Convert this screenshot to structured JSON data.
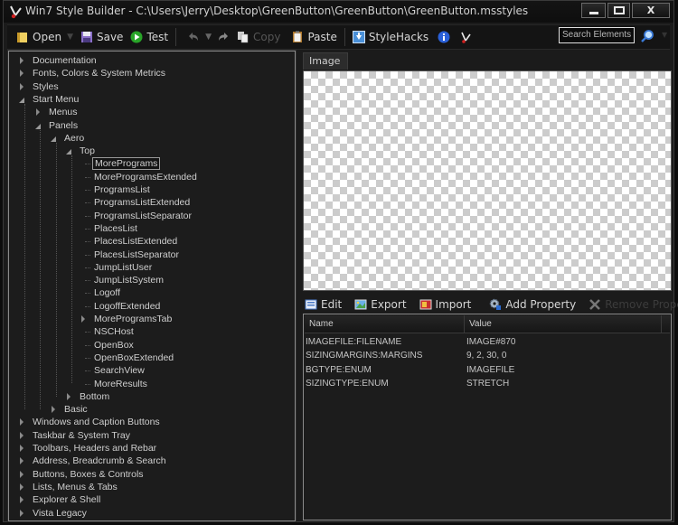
{
  "window": {
    "title": "Win7 Style Builder - C:\\Users\\Jerry\\Desktop\\GreenButton\\GreenButton\\GreenButton.msstyles",
    "caption_buttons": {
      "minimize": "▁",
      "maximize": "□",
      "close": "X"
    }
  },
  "toolbar": {
    "open": "Open",
    "save": "Save",
    "test": "Test",
    "copy": "Copy",
    "paste": "Paste",
    "stylehacks": "StyleHacks",
    "search_placeholder": "Search Elements"
  },
  "tree": {
    "items": [
      {
        "label": "Documentation",
        "level": 0,
        "state": "collapsed"
      },
      {
        "label": "Fonts, Colors & System Metrics",
        "level": 0,
        "state": "collapsed"
      },
      {
        "label": "Styles",
        "level": 0,
        "state": "collapsed"
      },
      {
        "label": "Start Menu",
        "level": 0,
        "state": "expanded"
      },
      {
        "label": "Menus",
        "level": 1,
        "state": "collapsed"
      },
      {
        "label": "Panels",
        "level": 1,
        "state": "expanded"
      },
      {
        "label": "Aero",
        "level": 2,
        "state": "expanded"
      },
      {
        "label": "Top",
        "level": 3,
        "state": "expanded"
      },
      {
        "label": "MorePrograms",
        "level": 4,
        "state": "leaf",
        "selected": true
      },
      {
        "label": "MoreProgramsExtended",
        "level": 4,
        "state": "leaf"
      },
      {
        "label": "ProgramsList",
        "level": 4,
        "state": "leaf"
      },
      {
        "label": "ProgramsListExtended",
        "level": 4,
        "state": "leaf"
      },
      {
        "label": "ProgramsListSeparator",
        "level": 4,
        "state": "leaf"
      },
      {
        "label": "PlacesList",
        "level": 4,
        "state": "leaf"
      },
      {
        "label": "PlacesListExtended",
        "level": 4,
        "state": "leaf"
      },
      {
        "label": "PlacesListSeparator",
        "level": 4,
        "state": "leaf"
      },
      {
        "label": "JumpListUser",
        "level": 4,
        "state": "leaf"
      },
      {
        "label": "JumpListSystem",
        "level": 4,
        "state": "leaf"
      },
      {
        "label": "Logoff",
        "level": 4,
        "state": "leaf"
      },
      {
        "label": "LogoffExtended",
        "level": 4,
        "state": "leaf"
      },
      {
        "label": "MoreProgramsTab",
        "level": 4,
        "state": "collapsed"
      },
      {
        "label": "NSCHost",
        "level": 4,
        "state": "leaf"
      },
      {
        "label": "OpenBox",
        "level": 4,
        "state": "leaf"
      },
      {
        "label": "OpenBoxExtended",
        "level": 4,
        "state": "leaf"
      },
      {
        "label": "SearchView",
        "level": 4,
        "state": "leaf"
      },
      {
        "label": "MoreResults",
        "level": 4,
        "state": "leaf"
      },
      {
        "label": "Bottom",
        "level": 3,
        "state": "collapsed"
      },
      {
        "label": "Basic",
        "level": 2,
        "state": "collapsed"
      },
      {
        "label": "Windows and Caption Buttons",
        "level": 0,
        "state": "collapsed"
      },
      {
        "label": "Taskbar & System Tray",
        "level": 0,
        "state": "collapsed"
      },
      {
        "label": "Toolbars, Headers and Rebar",
        "level": 0,
        "state": "collapsed"
      },
      {
        "label": "Address, Breadcrumb & Search",
        "level": 0,
        "state": "collapsed"
      },
      {
        "label": "Buttons, Boxes & Controls",
        "level": 0,
        "state": "collapsed"
      },
      {
        "label": "Lists, Menus & Tabs",
        "level": 0,
        "state": "collapsed"
      },
      {
        "label": "Explorer & Shell",
        "level": 0,
        "state": "collapsed"
      },
      {
        "label": "Vista Legacy",
        "level": 0,
        "state": "collapsed"
      }
    ]
  },
  "image_panel": {
    "tab_label": "Image"
  },
  "property_toolbar": {
    "edit": "Edit",
    "export": "Export",
    "import": "Import",
    "add_property": "Add Property",
    "remove_property": "Remove Property"
  },
  "property_grid": {
    "columns": [
      "Name",
      "Value"
    ],
    "rows": [
      {
        "name": "IMAGEFILE:FILENAME",
        "value": "IMAGE#870"
      },
      {
        "name": "SIZINGMARGINS:MARGINS",
        "value": "9, 2, 30, 0"
      },
      {
        "name": "BGTYPE:ENUM",
        "value": "IMAGEFILE"
      },
      {
        "name": "SIZINGTYPE:ENUM",
        "value": "STRETCH"
      }
    ]
  }
}
